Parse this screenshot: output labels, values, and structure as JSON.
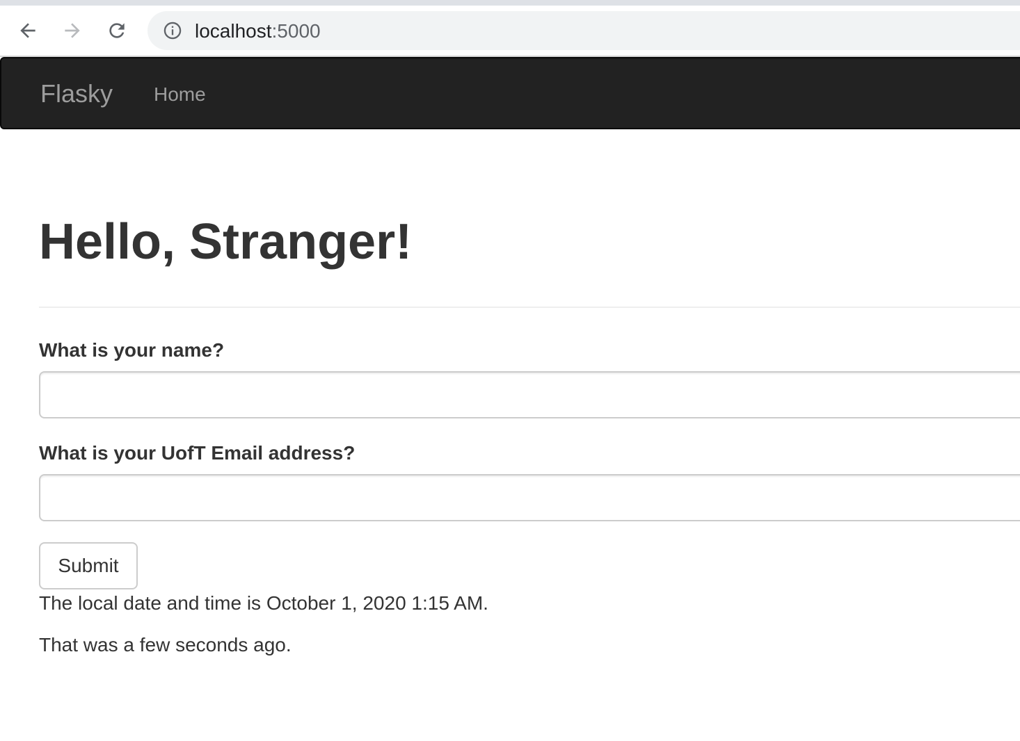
{
  "browser": {
    "url_host": "localhost",
    "url_port": ":5000"
  },
  "navbar": {
    "brand": "Flasky",
    "links": [
      {
        "label": "Home"
      }
    ]
  },
  "main": {
    "title": "Hello, Stranger!",
    "form": {
      "name_label": "What is your name?",
      "name_value": "",
      "email_label": "What is your UofT Email address?",
      "email_value": "",
      "submit_label": "Submit"
    },
    "datetime_text": "The local date and time is October 1, 2020 1:15 AM.",
    "relative_text": "That was a few seconds ago."
  },
  "colors": {
    "navbar_bg": "#222222",
    "navbar_text": "#9d9d9d",
    "body_text": "#333333"
  }
}
